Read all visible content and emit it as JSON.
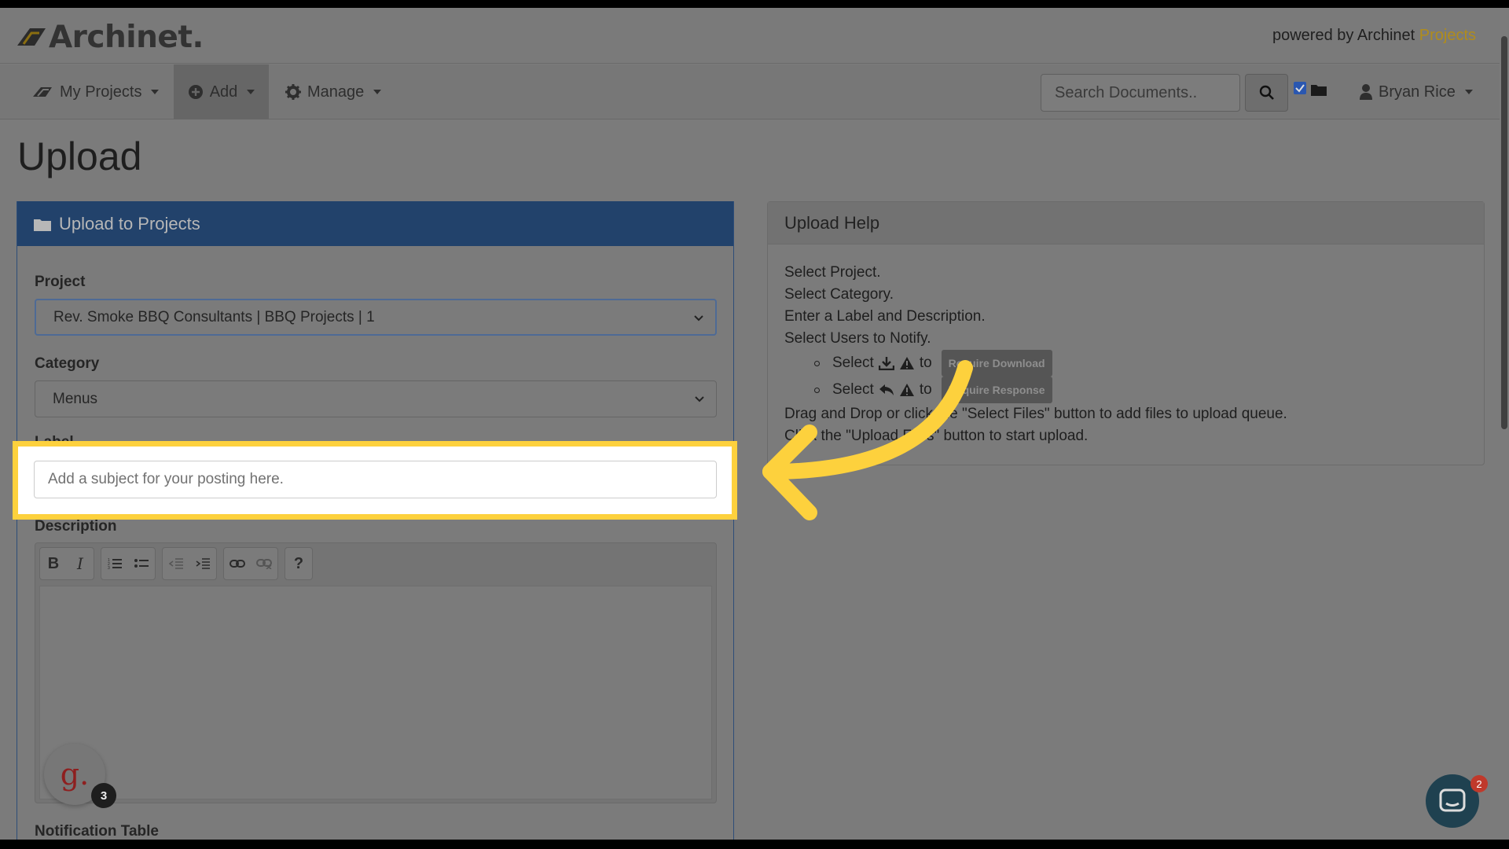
{
  "brand": {
    "logo_text": "Archinet.",
    "powered_prefix": "powered by Archinet ",
    "powered_highlight": "Projects"
  },
  "nav": {
    "items": [
      {
        "label": "My Projects",
        "icon": "hat-icon"
      },
      {
        "label": "Add",
        "icon": "plus-circle-icon"
      },
      {
        "label": "Manage",
        "icon": "gear-icon"
      }
    ],
    "search_placeholder": "Search Documents..",
    "user_name": "Bryan Rice"
  },
  "page": {
    "title": "Upload"
  },
  "upload_form": {
    "header": "Upload to Projects",
    "project_label": "Project",
    "project_value": "Rev. Smoke BBQ Consultants | BBQ Projects | 1",
    "category_label": "Category",
    "category_value": "Menus",
    "label_label": "Label",
    "label_placeholder": "Add a subject for your posting here.",
    "description_label": "Description",
    "toolbar": [
      "B",
      "I",
      "ordered-list",
      "bullet-list",
      "outdent",
      "indent",
      "link",
      "unlink",
      "?"
    ],
    "notification_label": "Notification Table"
  },
  "help": {
    "header": "Upload Help",
    "lines": [
      "Select Project.",
      "Select Category.",
      "Enter a Label and Description.",
      "Select Users to Notify."
    ],
    "sub1_prefix": "Select",
    "sub1_to": "to",
    "sub1_badge": "Require Download",
    "sub2_prefix": "Select",
    "sub2_to": "to",
    "sub2_badge": "Require Response",
    "line_drag": "Drag and Drop or click the \"Select Files\" button to add files to upload queue.",
    "line_upload": "Click the \"Upload Files\" button to start upload."
  },
  "overlays": {
    "grammarly_letter": "g.",
    "grammarly_count": "3",
    "chat_count": "2"
  },
  "colors": {
    "highlight": "#fdd13d",
    "panel_header": "#22426b",
    "accent_text": "#b08c1c"
  }
}
